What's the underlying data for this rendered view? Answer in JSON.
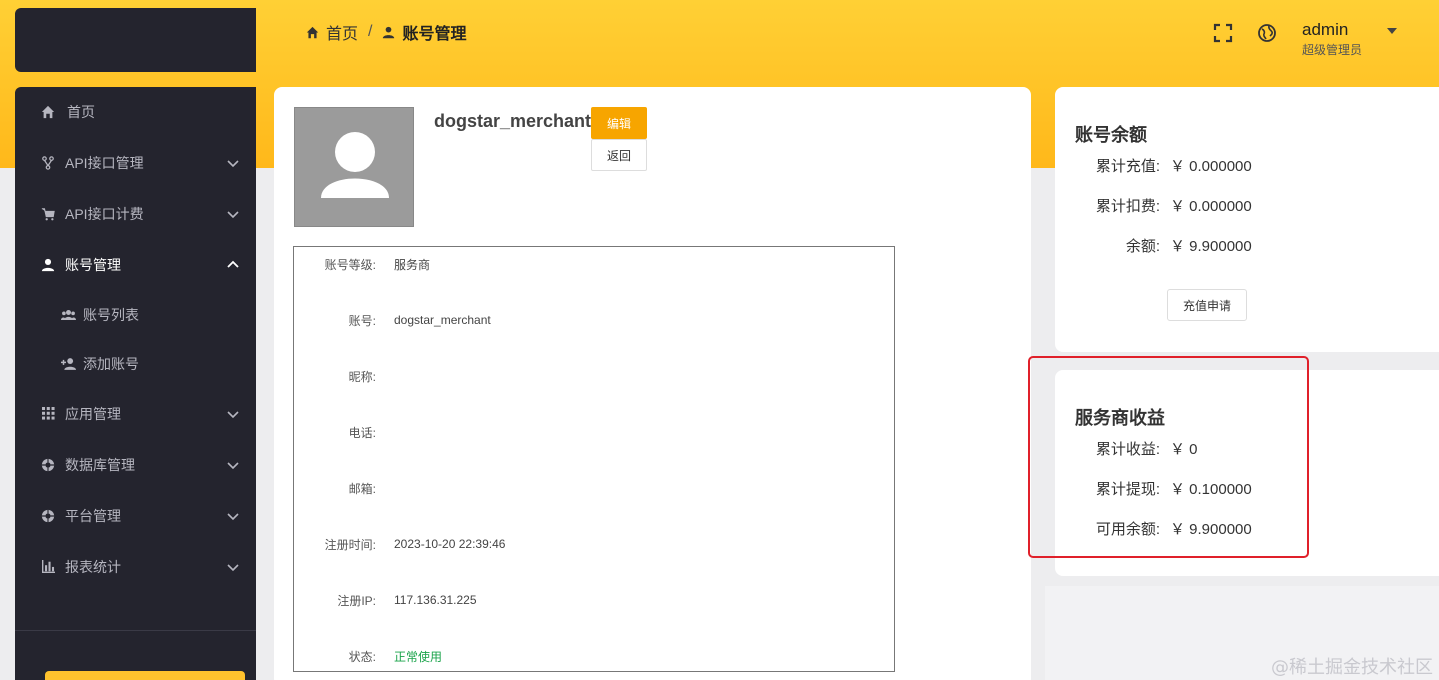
{
  "breadcrumb": {
    "home": "首页",
    "separator": "/",
    "current": "账号管理"
  },
  "header": {
    "user_name": "admin",
    "user_role": "超级管理员"
  },
  "sidebar": {
    "items": [
      {
        "label": "首页",
        "icon": "home-icon"
      },
      {
        "label": "API接口管理",
        "icon": "branch-icon"
      },
      {
        "label": "API接口计费",
        "icon": "cart-icon"
      },
      {
        "label": "账号管理",
        "icon": "user-icon"
      },
      {
        "label": "账号列表",
        "icon": "users-icon"
      },
      {
        "label": "添加账号",
        "icon": "user-add-icon"
      },
      {
        "label": "应用管理",
        "icon": "grid-icon"
      },
      {
        "label": "数据库管理",
        "icon": "database-icon"
      },
      {
        "label": "平台管理",
        "icon": "platform-icon"
      },
      {
        "label": "报表统计",
        "icon": "bar-chart-icon"
      }
    ]
  },
  "profile": {
    "username": "dogstar_merchant",
    "edit_label": "编辑",
    "back_label": "返回",
    "fields": [
      {
        "label": "账号等级:",
        "value": "服务商"
      },
      {
        "label": "账号:",
        "value": "dogstar_merchant"
      },
      {
        "label": "昵称:",
        "value": ""
      },
      {
        "label": "电话:",
        "value": ""
      },
      {
        "label": "邮箱:",
        "value": ""
      },
      {
        "label": "注册时间:",
        "value": "2023-10-20 22:39:46"
      },
      {
        "label": "注册IP:",
        "value": "117.136.31.225"
      },
      {
        "label": "状态:",
        "value": "正常使用"
      }
    ]
  },
  "balance": {
    "title": "账号余额",
    "rows": [
      {
        "label": "累计充值:",
        "value": "￥ 0.000000"
      },
      {
        "label": "累计扣费:",
        "value": "￥ 0.000000"
      },
      {
        "label": "余额:",
        "value": "￥ 9.900000"
      }
    ],
    "recharge_label": "充值申请"
  },
  "income": {
    "title": "服务商收益",
    "rows": [
      {
        "label": "累计收益:",
        "value": "￥ 0"
      },
      {
        "label": "累计提现:",
        "value": "￥ 0.100000"
      },
      {
        "label": "可用余额:",
        "value": "￥ 9.900000"
      }
    ]
  },
  "watermark": "@稀土掘金技术社区",
  "colors": {
    "accent": "#ffb81a",
    "sidebar_bg": "#24242e",
    "edit_button": "#f7a500",
    "status_green": "#1aa34a",
    "highlight_red": "#e0202a"
  }
}
